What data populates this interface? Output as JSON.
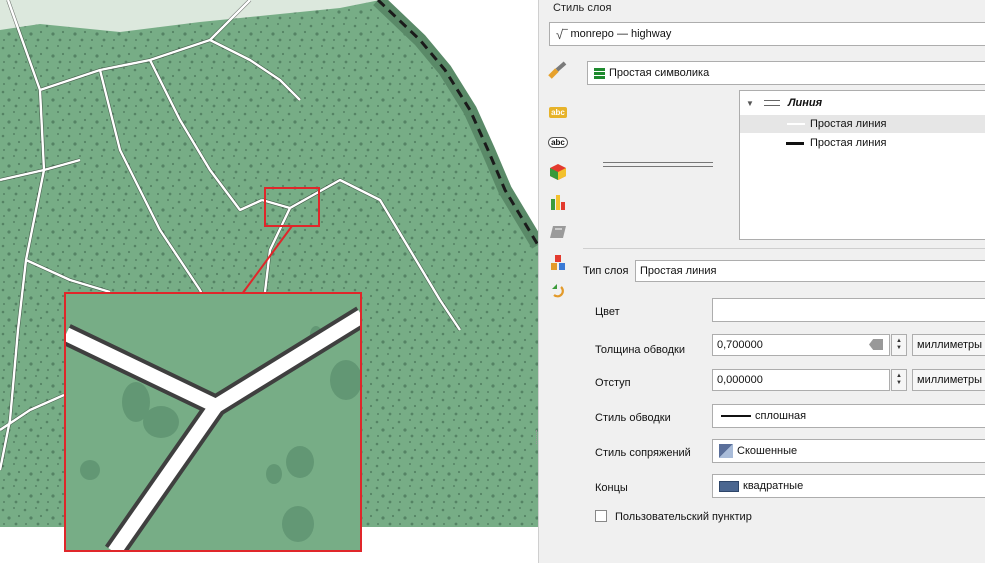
{
  "panel": {
    "title": "Стиль слоя",
    "layer_name": "monrepo — highway",
    "renderer": "Простая символика",
    "tree": {
      "root": "Линия",
      "child1": "Простая линия",
      "child2": "Простая линия"
    },
    "layer_type_label": "Тип слоя",
    "layer_type_value": "Простая линия"
  },
  "props": {
    "color_label": "Цвет",
    "width_label": "Толщина обводки",
    "width_value": "0,700000",
    "width_unit": "миллиметры",
    "offset_label": "Отступ",
    "offset_value": "0,000000",
    "offset_unit": "миллиметры",
    "stroke_label": "Стиль обводки",
    "stroke_value": "сплошная",
    "join_label": "Стиль сопряжений",
    "join_value": "Скошенные",
    "cap_label": "Концы",
    "cap_value": "квадратные",
    "custom_dash_label": "Пользовательский пунктир",
    "custom_dash_checked": false
  },
  "colors": {
    "forest": "#77ad86",
    "highlight": "#e0262a",
    "road": "#ffffff"
  }
}
